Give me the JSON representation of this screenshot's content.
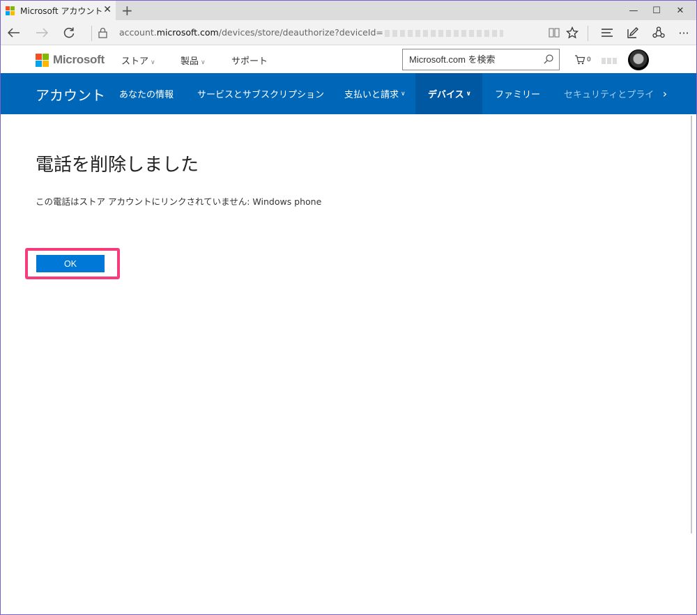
{
  "browser": {
    "tab_title": "Microsoft アカウント | アプ",
    "tab_close": "✕",
    "new_tab": "+",
    "url_prefix": "account.",
    "url_host": "microsoft.com",
    "url_path": "/devices/store/deauthorize?deviceId=",
    "window_controls": {
      "minimize": "—",
      "maximize": "☐",
      "close": "✕"
    },
    "more_label": "···"
  },
  "header": {
    "logo_text": "Microsoft",
    "nav": [
      {
        "label": "ストア",
        "has_dropdown": true
      },
      {
        "label": "製品",
        "has_dropdown": true
      },
      {
        "label": "サポート",
        "has_dropdown": false
      }
    ],
    "search_placeholder": "Microsoft.com を検索",
    "cart_count": "0"
  },
  "account_nav": {
    "title": "アカウント",
    "items": [
      {
        "label": "あなたの情報"
      },
      {
        "label": "サービスとサブスクリプション"
      },
      {
        "label": "支払いと請求",
        "has_dropdown": true
      },
      {
        "label": "デバイス",
        "has_dropdown": true,
        "active": true
      },
      {
        "label": "ファミリー"
      },
      {
        "label": "セキュリティとプライ.",
        "faded": true
      }
    ],
    "next_arrow": "›"
  },
  "main": {
    "title": "電話を削除しました",
    "message": "この電話はストア アカウントにリンクされていません: Windows phone",
    "ok_label": "OK"
  },
  "colors": {
    "accent": "#0067b8",
    "button": "#0078d7",
    "highlight": "#f73b7b"
  }
}
